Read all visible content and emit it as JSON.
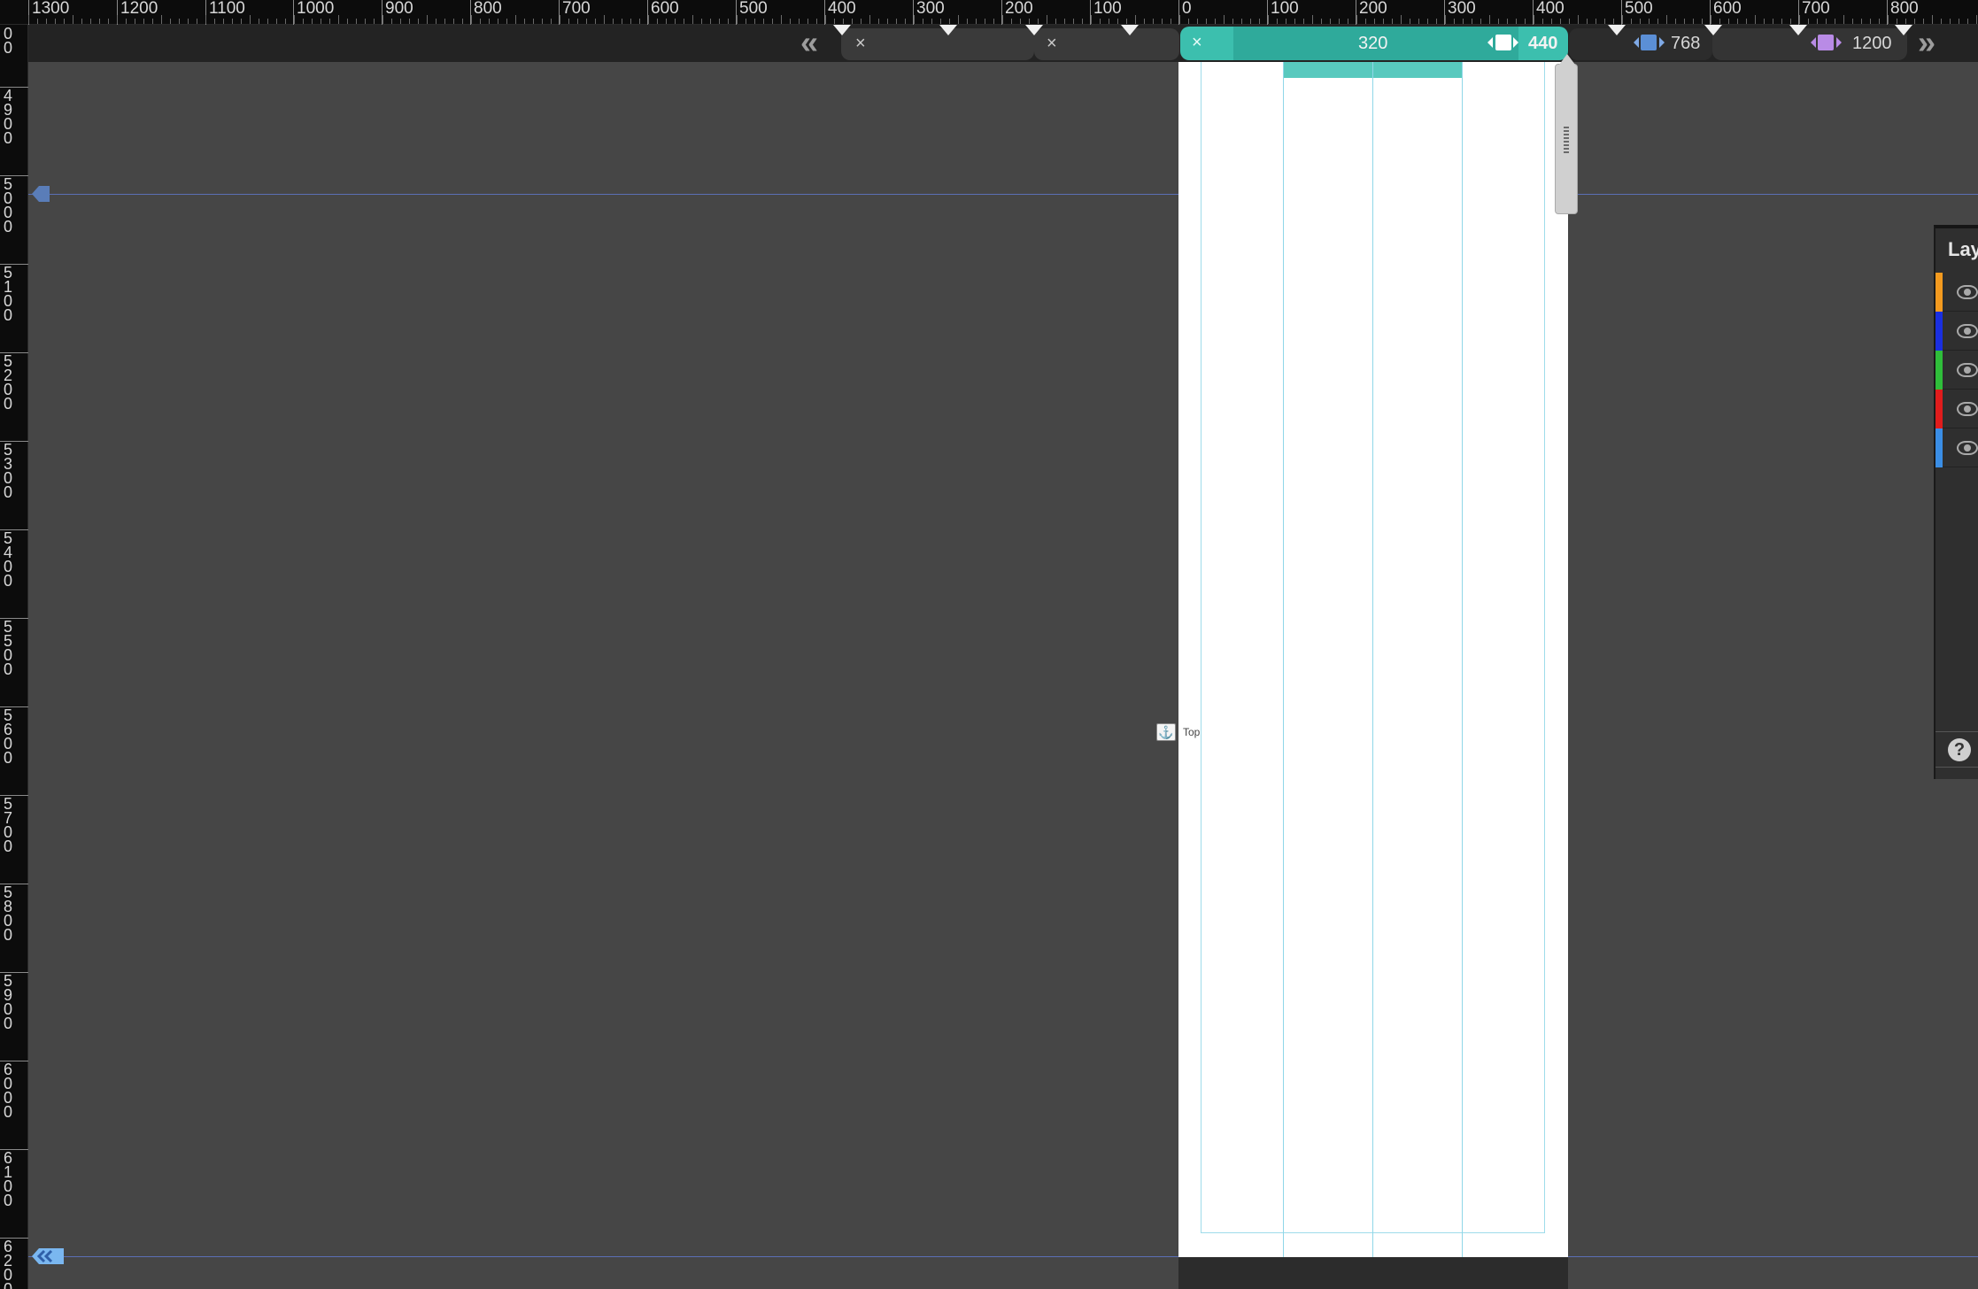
{
  "ruler_top": {
    "labels": [
      "1300",
      "1200",
      "1100",
      "1000",
      "900",
      "800",
      "700",
      "600",
      "500",
      "400",
      "300",
      "200",
      "100",
      "0",
      "100",
      "200",
      "300",
      "400",
      "500",
      "600",
      "700",
      "800"
    ]
  },
  "ruler_left": {
    "labels": [
      "00",
      "4900",
      "5000",
      "5100",
      "5200",
      "5300",
      "5400",
      "5500",
      "5600",
      "5700",
      "5800",
      "5900",
      "6000",
      "6100",
      "6200"
    ]
  },
  "breakpoints": {
    "nav_prev_icon": "double-chevron-left",
    "nav_next_icon": "double-chevron-right",
    "remove_symbol": "×",
    "active_min": "320",
    "active_max": "440",
    "tablet": "768",
    "desktop": "1200",
    "colors": {
      "active": "#3cbfae",
      "tablet_swatch": "#5b8fd6",
      "desktop_swatch": "#b98be6"
    }
  },
  "anchor": {
    "icon": "anchor-icon",
    "label": "Top"
  },
  "layers_panel": {
    "title": "Lay",
    "help": "?",
    "layers": [
      {
        "color": "#f39a1f",
        "icon": "eye-icon"
      },
      {
        "color": "#1a2fe0",
        "icon": "eye-icon"
      },
      {
        "color": "#2fbe3a",
        "icon": "eye-icon"
      },
      {
        "color": "#e01c1c",
        "icon": "eye-icon"
      },
      {
        "color": "#3a8ee6",
        "icon": "eye-icon"
      }
    ]
  }
}
